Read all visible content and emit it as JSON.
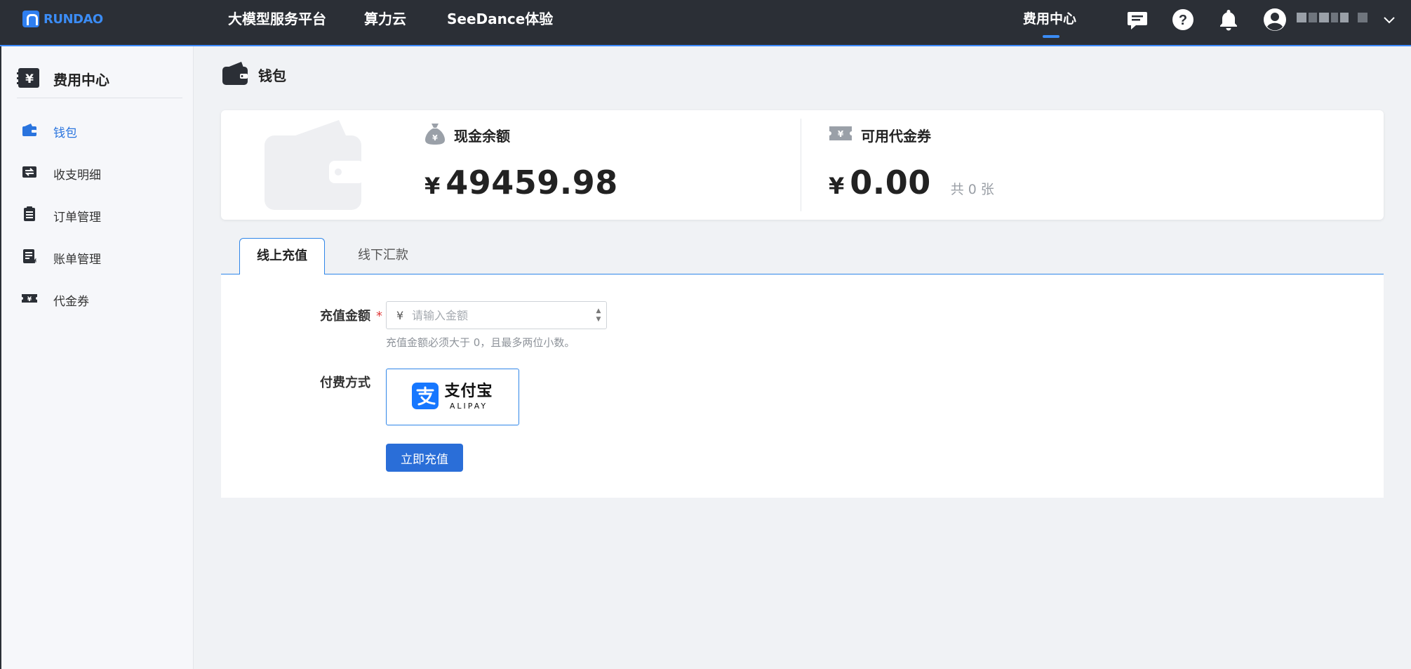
{
  "app": {
    "logo_text": "RUNDAO",
    "brand_color": "#3b8cf5"
  },
  "topnav": {
    "items": [
      {
        "label": "大模型服务平台"
      },
      {
        "label": "算力云"
      },
      {
        "label": "SeeDance体验"
      }
    ],
    "active": {
      "label": "费用中心"
    },
    "icons": [
      "message-icon",
      "help-icon",
      "bell-icon",
      "user-avatar-icon",
      "chevron-down-icon"
    ]
  },
  "sidebar": {
    "title": "费用中心",
    "items": [
      {
        "label": "钱包",
        "icon": "wallet-icon",
        "active": true
      },
      {
        "label": "收支明细",
        "icon": "transactions-icon",
        "active": false
      },
      {
        "label": "订单管理",
        "icon": "orders-icon",
        "active": false
      },
      {
        "label": "账单管理",
        "icon": "bills-icon",
        "active": false
      },
      {
        "label": "代金券",
        "icon": "voucher-icon",
        "active": false
      }
    ]
  },
  "page": {
    "title": "钱包"
  },
  "summary": {
    "cash": {
      "label": "现金余额",
      "currency": "¥",
      "amount": "49459.98"
    },
    "voucher": {
      "label": "可用代金券",
      "currency": "¥",
      "amount": "0.00",
      "count_text": "共 0 张"
    }
  },
  "tabs": [
    {
      "label": "线上充值",
      "active": true
    },
    {
      "label": "线下汇款",
      "active": false
    }
  ],
  "form": {
    "amount_label": "充值金额",
    "required_mark": "*",
    "currency": "¥",
    "amount_placeholder": "请输入金额",
    "amount_value": "",
    "amount_hint": "充值金额必须大于 0，且最多两位小数。",
    "pay_method_label": "付费方式",
    "pay_option": {
      "name_cn": "支付宝",
      "name_en": "ALIPAY",
      "color": "#1677ff"
    },
    "submit_label": "立即充值"
  }
}
